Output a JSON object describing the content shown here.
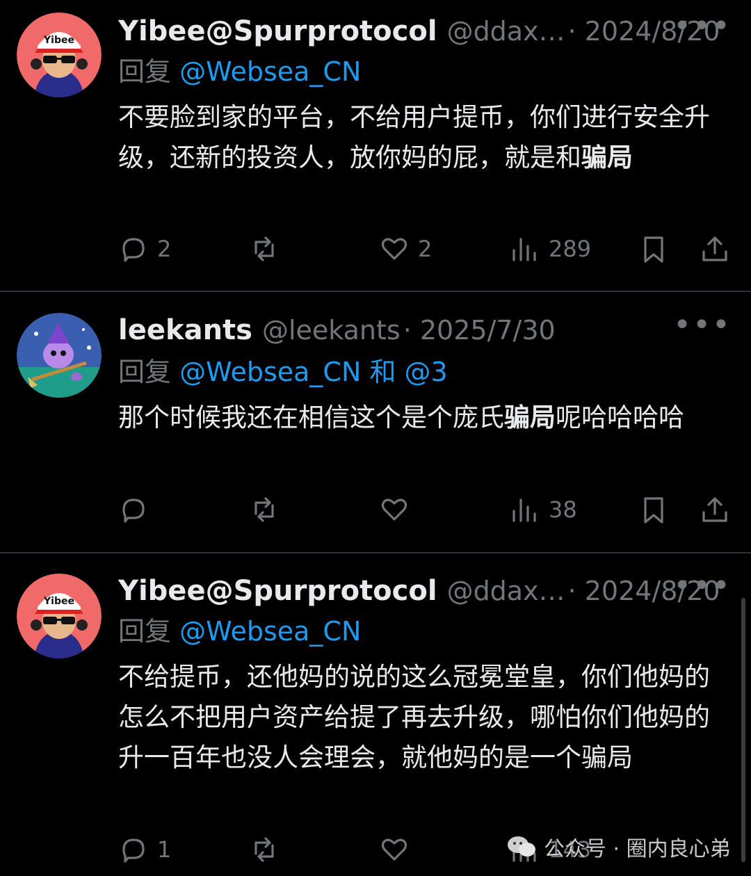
{
  "tweets": [
    {
      "name": "Yibee@Spurprotocol",
      "handle": "@ddax…",
      "date": "· 2024/8/20",
      "more": "•••",
      "reply_prefix": "回复",
      "reply_to": "@Websea_CN",
      "reply_extra": "",
      "text_before": "不要脸到家的平台，不给用户提币，你们进行安全升级，还新的投资人，放你妈的屁，就是和",
      "text_bold": "骗局",
      "text_after": "",
      "replies": "2",
      "retweets": "",
      "likes": "2",
      "views": "289",
      "avatar_label": "Yibee"
    },
    {
      "name": "leekants",
      "handle": "@leekants",
      "date": "· 2025/7/30",
      "more": "•••",
      "reply_prefix": "回复",
      "reply_to": "@Websea_CN 和 @3",
      "reply_extra": "",
      "text_before": "那个时候我还在相信这个是个庞氏",
      "text_bold": "骗局",
      "text_after": "呢哈哈哈哈",
      "replies": "",
      "retweets": "",
      "likes": "",
      "views": "38",
      "avatar_label": ""
    },
    {
      "name": "Yibee@Spurprotocol",
      "handle": "@ddax…",
      "date": "· 2024/8/20",
      "more": "•••",
      "reply_prefix": "回复",
      "reply_to": "@Websea_CN",
      "reply_extra": "",
      "text_before": "不给提币，还他妈的说的这么冠冕堂皇，你们他妈的怎么不把用户资产给提了再去升级，哪怕你们他妈的升一百年也没人会理会，就他妈的是一个骗局",
      "text_bold": "",
      "text_after": "",
      "replies": "1",
      "retweets": "",
      "likes": "",
      "views": "143",
      "avatar_label": "Yibee"
    }
  ],
  "watermark": "公众号 · 圈内良心弟",
  "icons": [
    "reply-icon",
    "retweet-icon",
    "like-icon",
    "views-icon",
    "bookmark-icon",
    "share-icon"
  ],
  "colors": {
    "background": "#000000",
    "text": "#e7e9ea",
    "muted": "#71767b",
    "mention": "#1d9bf0",
    "divider": "#2f3336"
  }
}
